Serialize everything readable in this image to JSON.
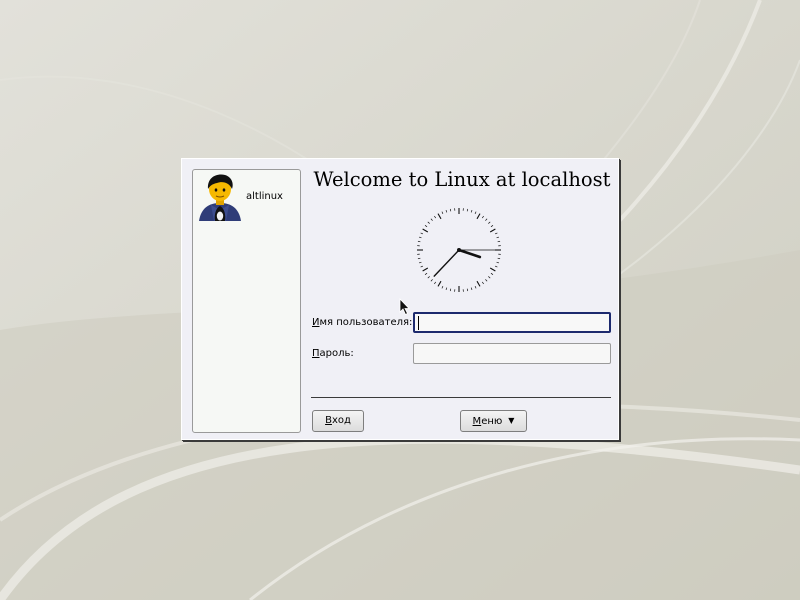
{
  "welcome_title": "Welcome to Linux at localhost",
  "users": [
    {
      "name": "altlinux",
      "icon": "penguin-user-avatar-icon"
    }
  ],
  "form": {
    "username": {
      "label_mnemonic": "И",
      "label_rest": "мя пользователя:",
      "value": ""
    },
    "password": {
      "label_mnemonic": "П",
      "label_rest": "ароль:",
      "value": ""
    }
  },
  "buttons": {
    "login": {
      "label_mnemonic": "В",
      "label_rest": "ход"
    },
    "menu": {
      "label_mnemonic": "М",
      "label_rest": "еню",
      "icon": "triangle-down-icon"
    }
  },
  "clock": {
    "icon": "analog-clock-icon",
    "hour": 3,
    "minute": 37,
    "second": 15
  },
  "colors": {
    "focus_border": "#1d2a6e",
    "dialog_bg": "#f0f0f6",
    "user_list_bg": "#f6f8f5"
  }
}
